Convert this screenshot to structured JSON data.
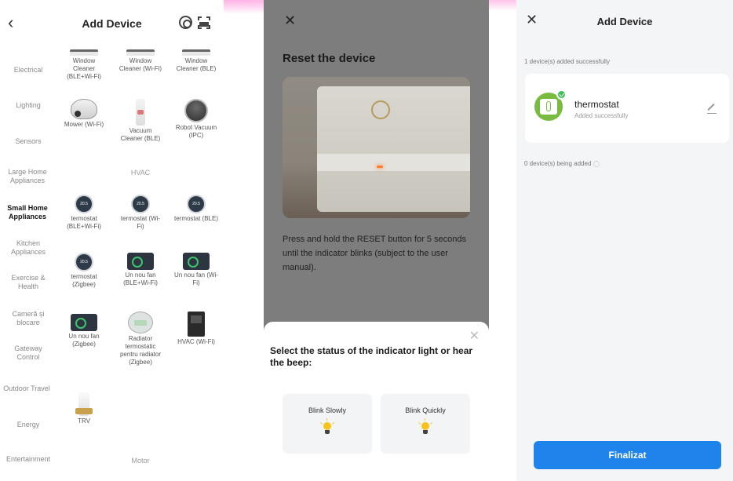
{
  "panel1": {
    "back_icon": "chevron-left-icon",
    "title": "Add Device",
    "categories": [
      {
        "label": "Electrical"
      },
      {
        "label": "Lighting"
      },
      {
        "label": "Sensors"
      },
      {
        "label": "Large Home Appliances"
      },
      {
        "label": "Small Home Appliances",
        "active": true
      },
      {
        "label": "Kitchen Appliances"
      },
      {
        "label": "Exercise & Health"
      },
      {
        "label": "Cameră și blocare"
      },
      {
        "label": "Gateway Control"
      },
      {
        "label": "Outdoor Travel"
      },
      {
        "label": "Energy"
      },
      {
        "label": "Entertainment"
      }
    ],
    "devices_top": [
      {
        "label": "Window Cleaner (BLE+Wi-Fi)",
        "icon": "window-cleaner"
      },
      {
        "label": "Window Cleaner (Wi-Fi)",
        "icon": "window-cleaner"
      },
      {
        "label": "Window Cleaner (BLE)",
        "icon": "window-cleaner"
      },
      {
        "label": "Mower (Wi-Fi)",
        "icon": "mower"
      },
      {
        "label": "Vacuum Cleaner (BLE)",
        "icon": "vacuum"
      },
      {
        "label": "Robot Vacuum (IPC)",
        "icon": "robot-vacuum"
      }
    ],
    "section_hvac": "HVAC",
    "thermostat_reading": "20.5",
    "devices_hvac": [
      {
        "label": "termostat (BLE+Wi-Fi)",
        "icon": "thermostat"
      },
      {
        "label": "termostat (Wi-Fi)",
        "icon": "thermostat"
      },
      {
        "label": "termostat (BLE)",
        "icon": "thermostat"
      },
      {
        "label": "termostat (Zigbee)",
        "icon": "thermostat"
      },
      {
        "label": "Un nou fan (BLE+Wi-Fi)",
        "icon": "fan"
      },
      {
        "label": "Un nou fan (Wi-Fi)",
        "icon": "fan"
      },
      {
        "label": "Un nou fan (Zigbee)",
        "icon": "fan"
      },
      {
        "label": "Radiator termostatic pentru radiator (Zigbee)",
        "icon": "radiator"
      },
      {
        "label": "HVAC (Wi-Fi)",
        "icon": "hvac"
      },
      {
        "label": "TRV",
        "icon": "trv"
      }
    ],
    "section_motor": "Motor"
  },
  "panel2": {
    "title": "Reset the device",
    "description": "Press and hold the RESET button for 5 seconds until the indicator blinks (subject to the user manual).",
    "sheet_question": "Select the status of the indicator light or hear the beep:",
    "options": [
      {
        "label": "Blink Slowly",
        "icon": "bulb-icon"
      },
      {
        "label": "Blink Quickly",
        "icon": "bulb-icon"
      }
    ],
    "overlay_color": "#7d7d7d"
  },
  "panel3": {
    "title": "Add Device",
    "added_count": "1 device(s) added successfully",
    "device": {
      "name": "thermostat",
      "status": "Added successfully",
      "icon_color": "#79bb3f"
    },
    "being_added": "0 device(s) being added",
    "finish_label": "Finalizat",
    "accent_color": "#1f83ec"
  }
}
